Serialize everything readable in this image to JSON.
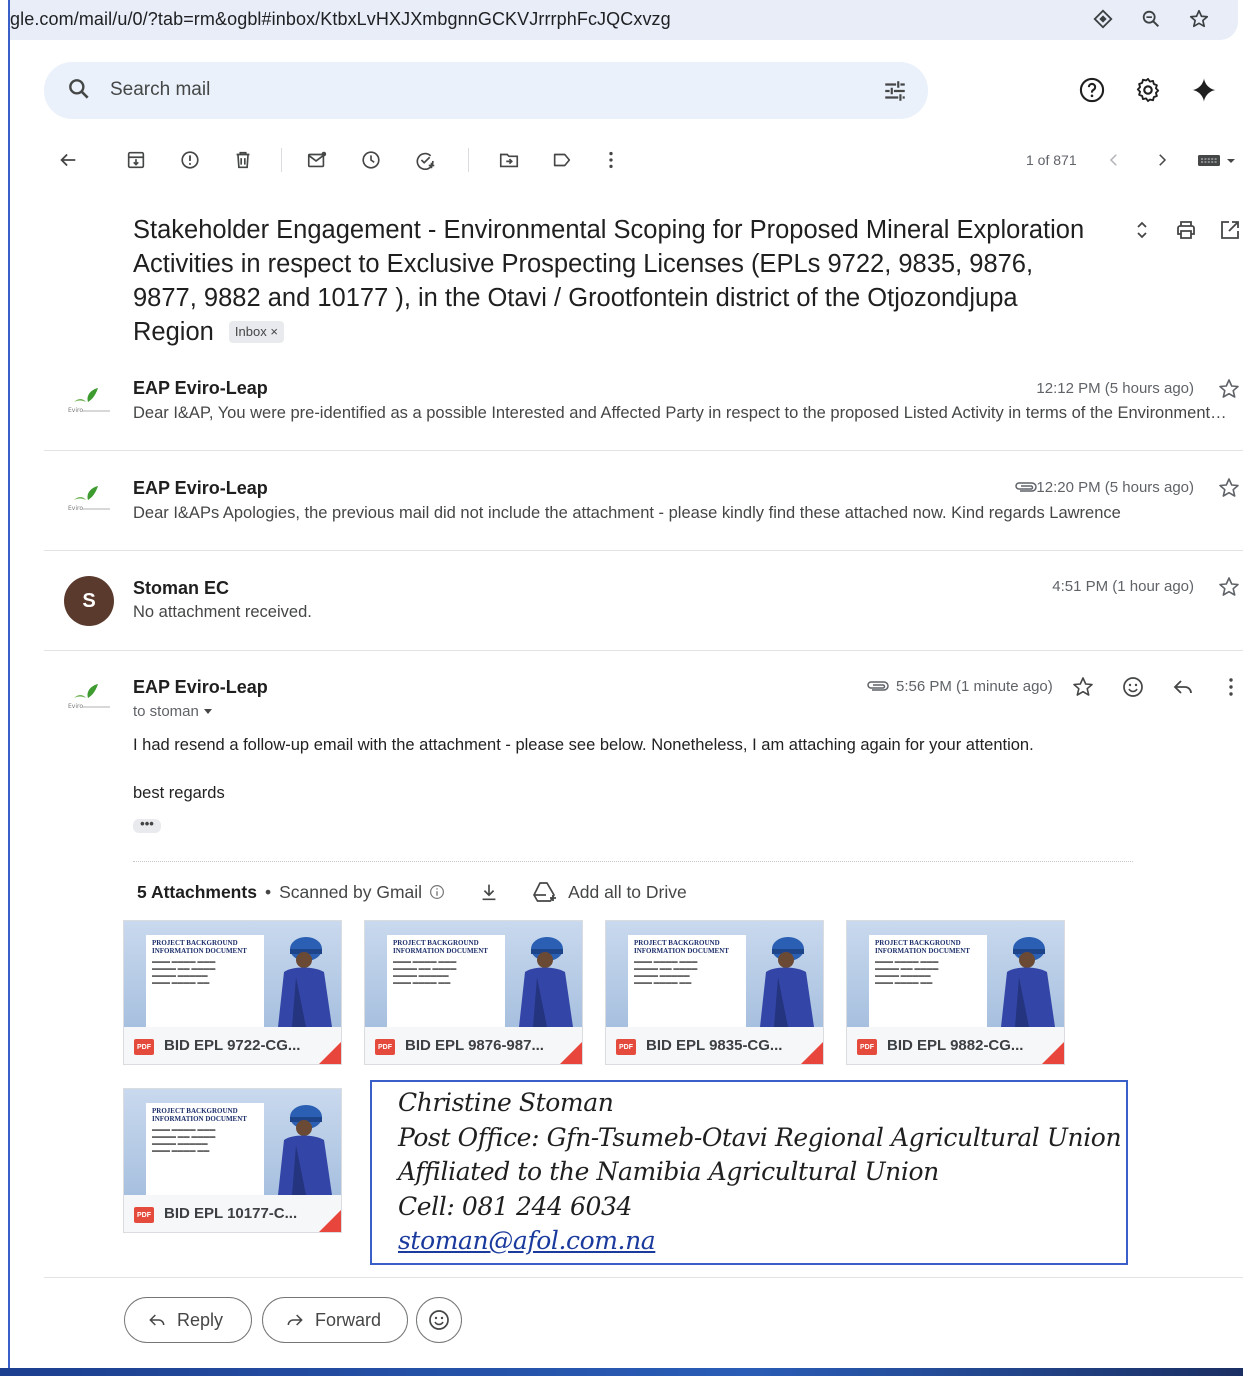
{
  "url": "gle.com/mail/u/0/?tab=rm&ogbl#inbox/KtbxLvHXJXmbgnnGCKVJrrrphFcJQCxvzg",
  "search": {
    "placeholder": "Search mail"
  },
  "toolbar": {
    "count": "1 of 871"
  },
  "subject": {
    "text": "Stakeholder Engagement - Environmental Scoping for Proposed Mineral Exploration Activities in respect to Exclusive Prospecting Licenses (EPLs 9722, 9835, 9876, 9877, 9882 and 10177 ), in the Otavi / Grootfontein district of the Otjozondjupa Region",
    "label": "Inbox",
    "label_close": "×"
  },
  "messages": [
    {
      "sender": "EAP Eviro-Leap",
      "time": "12:12 PM (5 hours ago)",
      "snippet": "Dear I&AP, You were pre-identified as a possible Interested and Affected Party in respect to the proposed Listed Activity in terms of the Environmental Management Act"
    },
    {
      "sender": "EAP Eviro-Leap",
      "time": "12:20 PM (5 hours ago)",
      "snippet": "Dear I&APs Apologies, the previous mail did not include the attachment - please kindly find these attached now. Kind regards Lawrence"
    },
    {
      "sender": "Stoman EC",
      "avatar_letter": "S",
      "time": "4:51 PM (1 hour ago)",
      "snippet": "No attachment received."
    },
    {
      "sender": "EAP Eviro-Leap",
      "time": "5:56 PM (1 minute ago)",
      "to": "to stoman",
      "body1": "I had resend a follow-up email with the attachment - please see below. Nonetheless, I am attaching again for your attention.",
      "body2": "best regards",
      "more": "•••"
    }
  ],
  "attachments": {
    "heading": "5 Attachments",
    "scanned": "Scanned by Gmail",
    "add_drive": "Add all to Drive",
    "thumb_title1": "PROJECT BACKGROUND",
    "thumb_title2": "INFORMATION DOCUMENT",
    "pdf_tag": "PDF",
    "files": [
      {
        "name": "BID EPL 9722-CG..."
      },
      {
        "name": "BID EPL 9876-987..."
      },
      {
        "name": "BID EPL 9835-CG..."
      },
      {
        "name": "BID EPL 9882-CG..."
      },
      {
        "name": "BID EPL 10177-C..."
      }
    ]
  },
  "signature": {
    "line1": "Christine Stoman",
    "line2": "Post Office: Gfn-Tsumeb-Otavi Regional Agricultural Union",
    "line3": "Affiliated to the Namibia Agricultural Union",
    "line4": "Cell: 081 244 6034",
    "email": "stoman@afol.com.na"
  },
  "actions": {
    "reply": "Reply",
    "forward": "Forward"
  },
  "colors": {
    "accent_blue": "#3b5fc9",
    "pdf_red": "#e54b3c",
    "avatar_brown": "#5b3a2e",
    "search_bg": "#eaf1fb"
  }
}
